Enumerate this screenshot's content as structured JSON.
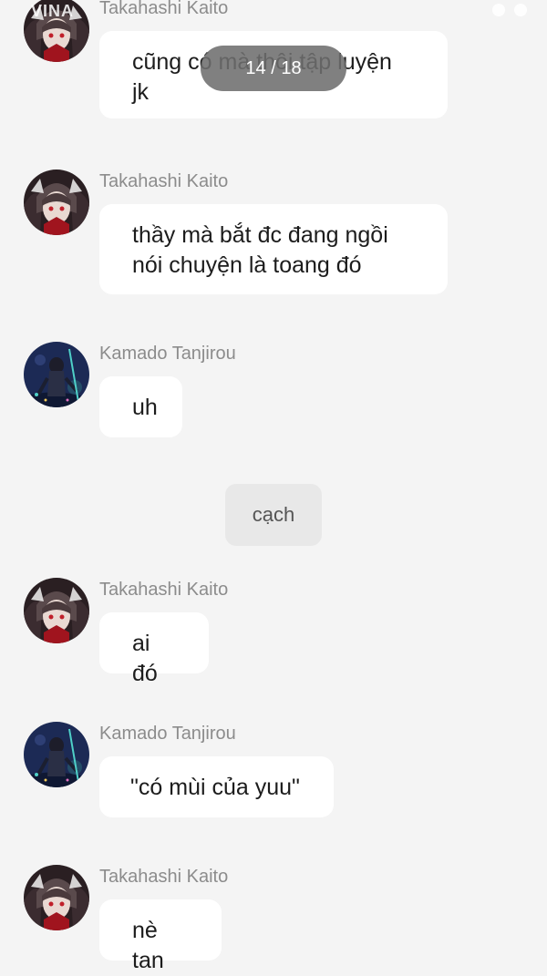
{
  "status_bar": {
    "carrier": "VINA"
  },
  "counter": "14 / 18",
  "messages": [
    {
      "sender": "Takahashi Kaito",
      "text_lines": [
        "cũng có mà thôi tập luyện",
        "jk"
      ],
      "avatar_icon": "takahashi-avatar-icon"
    },
    {
      "sender": "Takahashi Kaito",
      "text_lines": [
        "thầy mà bắt đc đang ngồi",
        "nói chuyện là toang đó"
      ],
      "avatar_icon": "takahashi-avatar-icon"
    },
    {
      "sender": "Kamado Tanjirou",
      "text_lines": [
        "uh"
      ],
      "avatar_icon": "tanjirou-avatar-icon"
    },
    {
      "sender": "Takahashi Kaito",
      "text_lines": [
        "ai đó"
      ],
      "avatar_icon": "takahashi-avatar-icon"
    },
    {
      "sender": "Kamado Tanjirou",
      "text_lines": [
        "\"có mùi của yuu\""
      ],
      "avatar_icon": "tanjirou-avatar-icon"
    },
    {
      "sender": "Takahashi Kaito",
      "text_lines": [
        "nè tan"
      ],
      "avatar_icon": "takahashi-avatar-icon"
    }
  ],
  "system_message": "cạch",
  "colors": {
    "background": "#f4f4f4",
    "bubble": "#ffffff",
    "sender_name": "#8c8c8c",
    "message_text": "#1c1c1c",
    "system_pill": "#e8e8e8"
  }
}
